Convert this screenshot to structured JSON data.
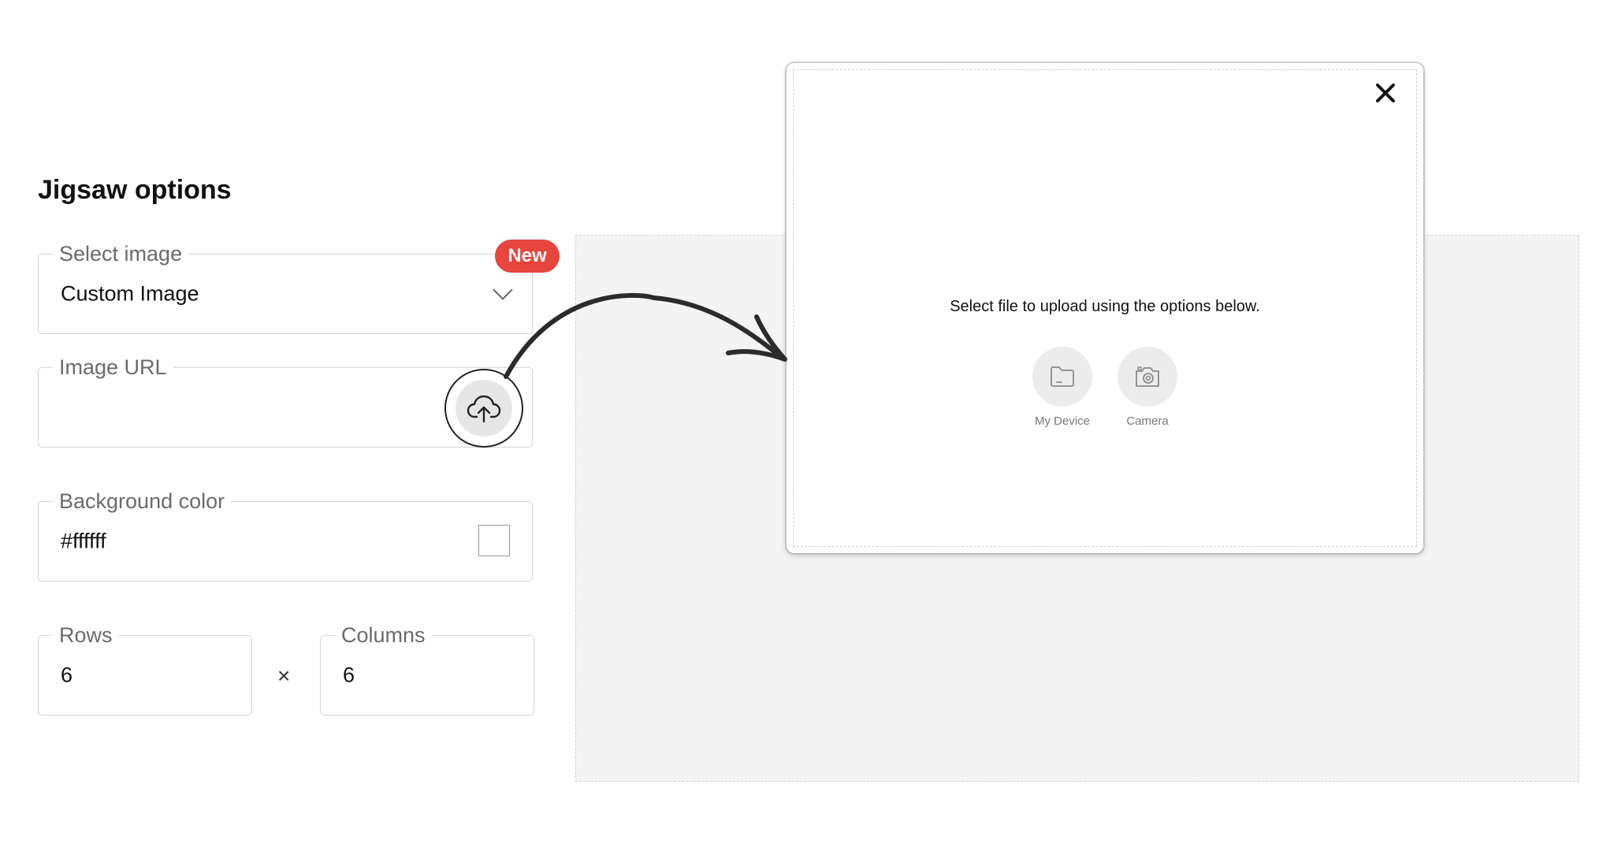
{
  "page": {
    "title": "Jigsaw options"
  },
  "select_image": {
    "label": "Select image",
    "value": "Custom Image",
    "badge": "New"
  },
  "image_url": {
    "label": "Image URL",
    "value": ""
  },
  "background_color": {
    "label": "Background color",
    "value": "#ffffff",
    "swatch_color": "#ffffff"
  },
  "grid": {
    "rows_label": "Rows",
    "rows_value": "6",
    "separator": "×",
    "columns_label": "Columns",
    "columns_value": "6"
  },
  "upload_modal": {
    "message": "Select file to upload using the options below.",
    "options": [
      {
        "label": "My Device",
        "icon": "folder-icon"
      },
      {
        "label": "Camera",
        "icon": "camera-icon"
      }
    ]
  },
  "colors": {
    "badge": "#e8453c",
    "preview_bg": "#f4f4f4",
    "border": "#d4d4d4"
  }
}
